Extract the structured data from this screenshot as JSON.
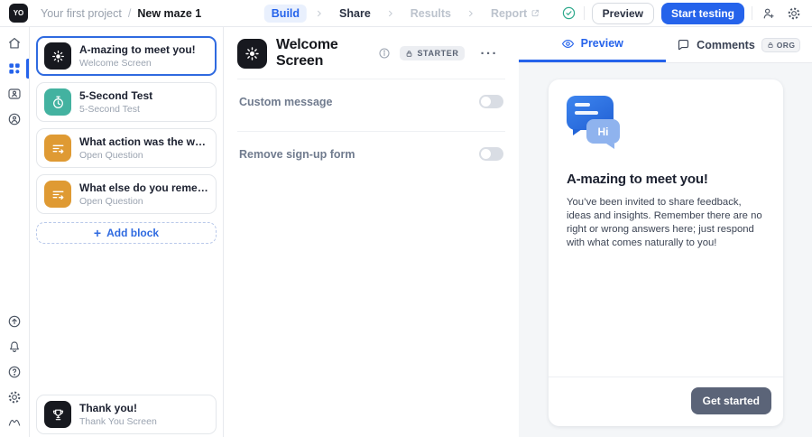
{
  "topbar": {
    "logo_text": "YO",
    "breadcrumb": {
      "project": "Your first project",
      "separator": "/",
      "current": "New maze 1"
    },
    "nav": [
      {
        "label": "Build",
        "state": "active"
      },
      {
        "label": "Share",
        "state": "default"
      },
      {
        "label": "Results",
        "state": "disabled"
      },
      {
        "label": "Report",
        "state": "disabled",
        "external_link": true
      }
    ],
    "preview_button": "Preview",
    "start_testing_button": "Start testing"
  },
  "block_list": {
    "items": [
      {
        "title": "A-mazing to meet you!",
        "subtitle": "Welcome Screen",
        "icon": "welcome-sun-icon",
        "color": "#17191f",
        "selected": true
      },
      {
        "title": "5-Second Test",
        "subtitle": "5-Second Test",
        "icon": "stopwatch-icon",
        "color": "#43b2a0",
        "selected": false
      },
      {
        "title": "What action was the webpage a...",
        "subtitle": "Open Question",
        "icon": "open-question-icon",
        "color": "#df9a33",
        "selected": false
      },
      {
        "title": "What else do you remember fro...",
        "subtitle": "Open Question",
        "icon": "open-question-icon",
        "color": "#df9a33",
        "selected": false
      }
    ],
    "add_block": {
      "plus": "+",
      "label": "Add block"
    },
    "thank_you": {
      "title": "Thank you!",
      "subtitle": "Thank You Screen",
      "icon": "trophy-icon",
      "color": "#17191f"
    }
  },
  "editor": {
    "title": "Welcome Screen",
    "starter_badge": "STARTER",
    "menu_ellipsis": "···",
    "settings": [
      {
        "label": "Custom message",
        "enabled": false
      },
      {
        "label": "Remove sign-up form",
        "enabled": false
      }
    ]
  },
  "preview_panel": {
    "tabs": [
      {
        "label": "Preview",
        "active": true
      },
      {
        "label": "Comments",
        "active": false
      }
    ],
    "org_badge": "ORG",
    "card": {
      "bubble_text": "Hi",
      "heading": "A-mazing to meet you!",
      "body": "You’ve been invited to share feedback, ideas and insights. Remember there are no right or wrong answers here; just respond with what comes naturally to you!",
      "cta": "Get started"
    }
  },
  "colors": {
    "accent_blue": "#2563eb",
    "selected_block_border": "#2f6ae0",
    "welcome_block": "#17191f",
    "five_second_block": "#43b2a0",
    "open_question_block": "#df9a33",
    "get_started_button": "#5b6478",
    "saved_check_green": "#2ea98c",
    "panel_background": "#f4f6f8"
  }
}
